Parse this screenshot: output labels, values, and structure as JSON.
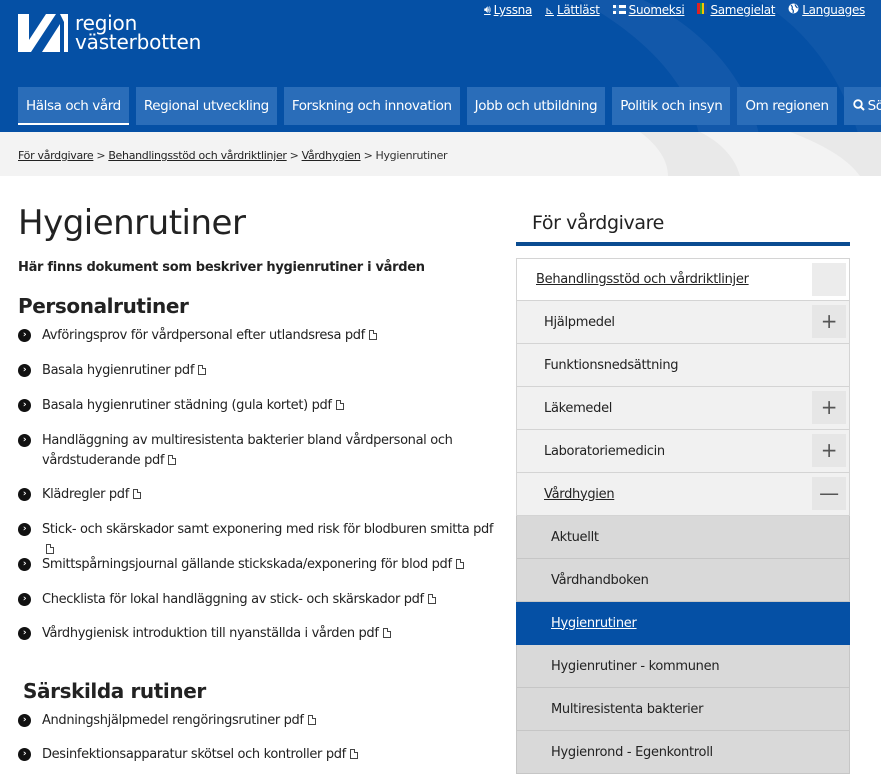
{
  "logo": {
    "line1": "region",
    "line2": "västerbotten"
  },
  "utility": [
    {
      "label": "Lyssna",
      "icon": "speaker-icon"
    },
    {
      "label": "Lättläst",
      "icon": "easy-read-icon"
    },
    {
      "label": "Suomeksi",
      "icon": "finnish-flag-icon"
    },
    {
      "label": "Samegielat",
      "icon": "sami-flag-icon"
    },
    {
      "label": "Languages",
      "icon": "globe-icon"
    }
  ],
  "nav": [
    {
      "label": "Hälsa och vård",
      "active": true
    },
    {
      "label": "Regional utveckling"
    },
    {
      "label": "Forskning och innovation"
    },
    {
      "label": "Jobb och utbildning"
    },
    {
      "label": "Politik och insyn"
    },
    {
      "label": "Om regionen"
    }
  ],
  "search_label": "Sök",
  "breadcrumb": {
    "items": [
      "För vårdgivare",
      "Behandlingsstöd och vårdriktlinjer",
      "Vårdhygien"
    ],
    "current": "Hygienrutiner",
    "sep": ">"
  },
  "page": {
    "title": "Hygienrutiner",
    "lead": "Här finns dokument som beskriver hygienrutiner i vården",
    "section1": "Personalrutiner",
    "section2": "Särskilda rutiner"
  },
  "personal_docs": [
    "Avföringsprov för vårdpersonal efter utlandsresa pdf",
    "Basala hygienrutiner pdf",
    "Basala hygienrutiner städning (gula kortet) pdf",
    "Handläggning av multiresistenta bakterier bland vårdpersonal och vårdstuderande pdf",
    "Klädregler pdf",
    "Stick- och skärskador samt exponering med risk för blodburen smitta pdf",
    "Smittspårningsjournal gällande stickskada/exponering för blod pdf",
    "Checklista för lokal handläggning av stick- och skärskador pdf",
    "Vårdhygienisk introduktion till nyanställda i vården pdf"
  ],
  "special_docs": [
    "Andningshjälpmedel rengöringsrutiner pdf",
    "Desinfektionsapparatur skötsel och kontroller pdf"
  ],
  "sidebar": {
    "title": "För vårdgivare",
    "items": [
      {
        "label": "Behandlingsstöd och vårdriktlinjer",
        "level": 1,
        "toggle": ""
      },
      {
        "label": "Hjälpmedel",
        "level": 2,
        "toggle": "+"
      },
      {
        "label": "Funktionsnedsättning",
        "level": 2
      },
      {
        "label": "Läkemedel",
        "level": 2,
        "toggle": "+"
      },
      {
        "label": "Laboratoriemedicin",
        "level": 2,
        "toggle": "+"
      },
      {
        "label": "Vårdhygien",
        "level": 2,
        "toggle": "—"
      },
      {
        "label": "Aktuellt",
        "level": 3
      },
      {
        "label": "Vårdhandboken",
        "level": 3
      },
      {
        "label": "Hygienrutiner",
        "level": 3,
        "current": true
      },
      {
        "label": "Hygienrutiner - kommunen",
        "level": 3
      },
      {
        "label": "Multiresistenta bakterier",
        "level": 3
      },
      {
        "label": "Hygienrond - Egenkontroll",
        "level": 3
      }
    ]
  },
  "colors": {
    "header": "#0550a5",
    "nav_button": "#2a6db9",
    "sidebar_rule": "#0a4c91"
  }
}
